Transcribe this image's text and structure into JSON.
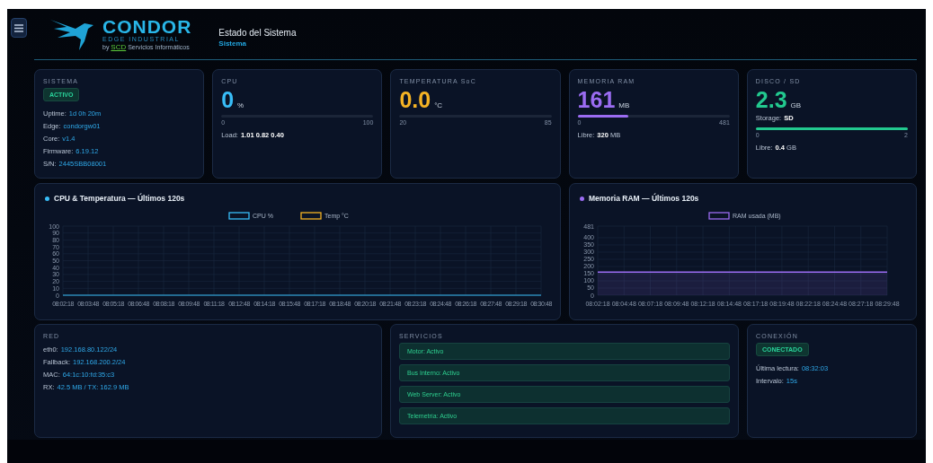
{
  "header": {
    "logo": {
      "name": "CONDOR",
      "tagline": "EDGE INDUSTRIAL",
      "by": "by",
      "brand": "SCD",
      "company": "Servicios Informáticos"
    },
    "title": "Estado del Sistema",
    "subtitle": "Sistema"
  },
  "system": {
    "label": "SISTEMA",
    "status": "ACTIVO",
    "lines": [
      {
        "key": "Uptime:",
        "value": "1d 0h 20m"
      },
      {
        "key": "Edge:",
        "value": "condorgw01"
      },
      {
        "key": "Core:",
        "value": "v1.4"
      },
      {
        "key": "Firmware:",
        "value": "6.19.12"
      },
      {
        "key": "S/N:",
        "value": "2445SBB08001"
      }
    ]
  },
  "metrics": [
    {
      "label": "CPU",
      "value": "0",
      "unit": "%",
      "color": "#38bdf8",
      "min": "0",
      "max": "100",
      "lines": [
        {
          "key": "Load:",
          "value": "**1.01 0.82 0.40**"
        }
      ]
    },
    {
      "label": "TEMPERATURA SoC",
      "value": "0.0",
      "unit": "°C",
      "color": "#f5b324",
      "min": "20",
      "max": "85"
    },
    {
      "label": "MEMORIA RAM",
      "value": "161",
      "unit": "MB",
      "color": "#9b6cf2",
      "level": 0.335,
      "min": "0",
      "max": "481",
      "lines": [
        {
          "key": "Libre:",
          "value": "**320** MB"
        }
      ]
    },
    {
      "label": "DISCO / SD",
      "value": "2.3",
      "unit": "GB",
      "color": "#22c98f",
      "storage": {
        "key": "Storage:",
        "value": "**SD**"
      },
      "level": 1,
      "min": "0",
      "max": "2",
      "lines": [
        {
          "key": "Libre:",
          "value": "**0.4** GB"
        }
      ]
    }
  ],
  "charts": [
    {
      "title": "CPU & Temperatura — Últimos 120s",
      "color": "#38bdf8",
      "chart_data": {
        "type": "line",
        "categories": [
          "08:02:18",
          "08:03:48",
          "08:05:18",
          "08:06:48",
          "08:08:18",
          "08:09:48",
          "08:11:18",
          "08:12:48",
          "08:14:18",
          "08:15:48",
          "08:17:18",
          "08:18:48",
          "08:20:18",
          "08:21:48",
          "08:23:18",
          "08:24:48",
          "08:26:18",
          "08:27:48",
          "08:29:18",
          "08:30:48"
        ],
        "ylim": [
          0,
          100
        ],
        "grid": true,
        "legend": true,
        "yticks": [
          0,
          10,
          20,
          30,
          40,
          50,
          60,
          70,
          80,
          90,
          100
        ],
        "series": [
          {
            "name": "CPU %",
            "color": "#38bdf8",
            "values": [
              0,
              0,
              0,
              0,
              0,
              0,
              0,
              0,
              0,
              0,
              0,
              0,
              0,
              0,
              0,
              0,
              0,
              0,
              0,
              0
            ]
          },
          {
            "name": "Temp °C",
            "color": "#f5b324",
            "values": [
              null,
              null,
              null,
              null,
              null,
              null,
              null,
              null,
              null,
              null,
              null,
              null,
              null,
              null,
              null,
              null,
              null,
              null,
              null,
              null
            ]
          }
        ]
      }
    },
    {
      "title": "Memoria RAM — Últimos 120s",
      "color": "#9b6cf2",
      "chart_data": {
        "type": "area",
        "categories": [
          "08:02:18",
          "08:04:48",
          "08:07:18",
          "08:09:48",
          "08:12:18",
          "08:14:48",
          "08:17:18",
          "08:19:48",
          "08:22:18",
          "08:24:48",
          "08:27:18",
          "08:29:48"
        ],
        "ylim": [
          0,
          481
        ],
        "grid": true,
        "legend": true,
        "yticks": [
          0,
          50,
          100,
          150,
          200,
          250,
          300,
          350,
          400,
          481
        ],
        "series": [
          {
            "name": "RAM usada (MB)",
            "color": "#9b6cf2",
            "values": [
              161,
              161,
              161,
              161,
              161,
              161,
              161,
              161,
              161,
              161,
              161,
              161
            ]
          }
        ]
      }
    }
  ],
  "network": {
    "label": "RED",
    "lines": [
      {
        "key": "eth0:",
        "value": "192.168.80.122/24"
      },
      {
        "key": "Fallback:",
        "value": "192.168.200.2/24"
      },
      {
        "key": "MAC:",
        "value": "64:1c:10:fd:35:c3"
      },
      {
        "key": "RX:",
        "value": "42.5 MB / TX: 162.9 MB"
      }
    ]
  },
  "services": {
    "label": "SERVICIOS",
    "items": [
      "Motor: Activo",
      "Bus Interno: Activo",
      "Web Server: Activo",
      "Telemetría: Activo"
    ]
  },
  "connection": {
    "label": "CONEXIÓN",
    "status": "CONECTADO",
    "lines": [
      {
        "key": "Última lectura:",
        "value": "08:32:03"
      },
      {
        "key": "Intervalo:",
        "value": "15s"
      }
    ]
  }
}
